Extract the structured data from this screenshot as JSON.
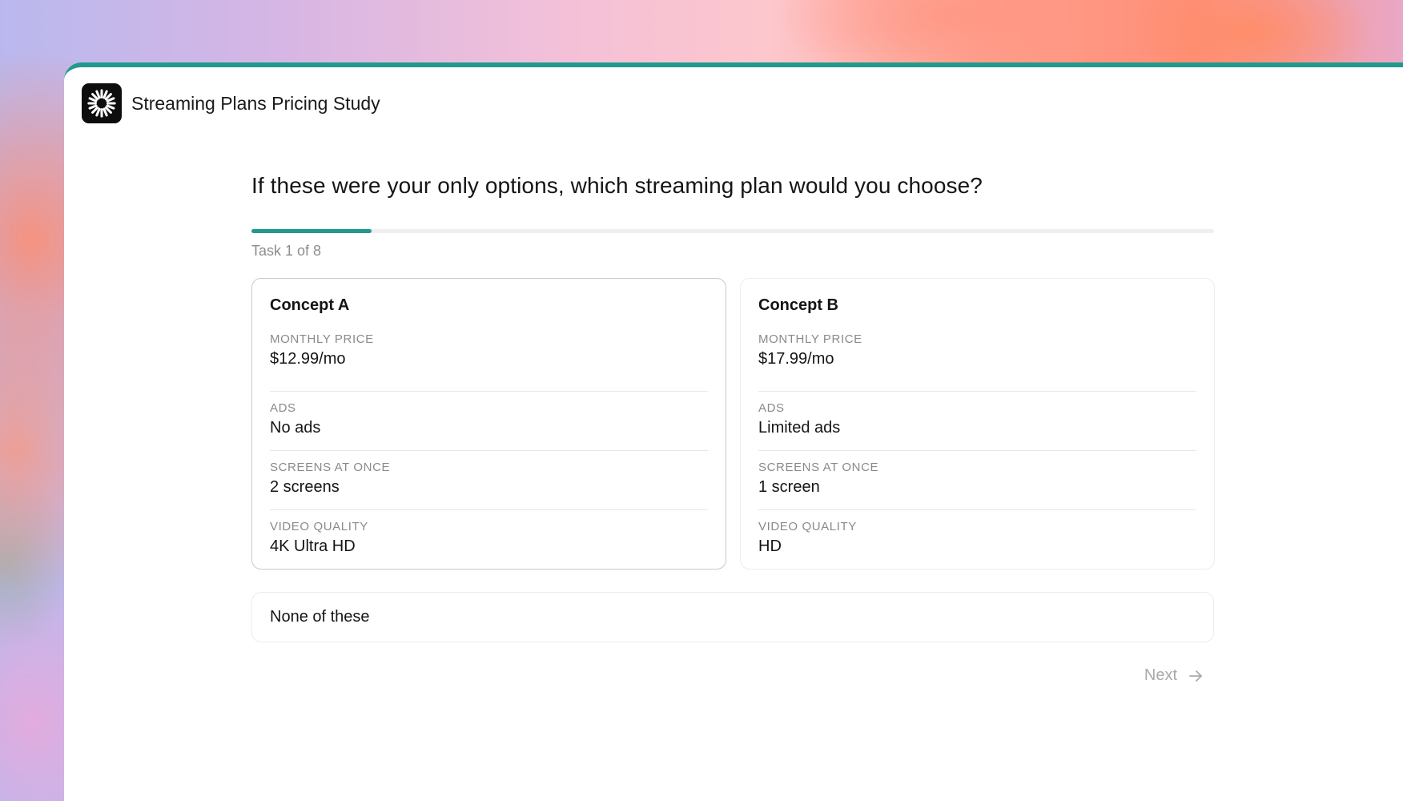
{
  "app": {
    "title": "Streaming Plans Pricing Study",
    "logo_icon": "sunburst-logo-icon"
  },
  "question": "If these were your only options, which streaming plan would you choose?",
  "progress": {
    "current": 1,
    "total": 8,
    "label": "Task 1 of 8",
    "fraction": 0.125
  },
  "concepts": [
    {
      "title": "Concept A",
      "attributes": [
        {
          "label": "MONTHLY PRICE",
          "value": "$12.99/mo"
        },
        {
          "label": "ADS",
          "value": "No ads"
        },
        {
          "label": "SCREENS AT ONCE",
          "value": "2 screens"
        },
        {
          "label": "VIDEO QUALITY",
          "value": "4K Ultra HD"
        }
      ]
    },
    {
      "title": "Concept B",
      "attributes": [
        {
          "label": "MONTHLY PRICE",
          "value": "$17.99/mo"
        },
        {
          "label": "ADS",
          "value": "Limited ads"
        },
        {
          "label": "SCREENS AT ONCE",
          "value": "1 screen"
        },
        {
          "label": "VIDEO QUALITY",
          "value": "HD"
        }
      ]
    }
  ],
  "none_option": "None of these",
  "next": {
    "label": "Next",
    "icon": "arrow-right-icon"
  },
  "colors": {
    "accent": "#1f9a8d",
    "muted_text": "#8a8a8a",
    "disabled_text": "#a9a9a9"
  }
}
